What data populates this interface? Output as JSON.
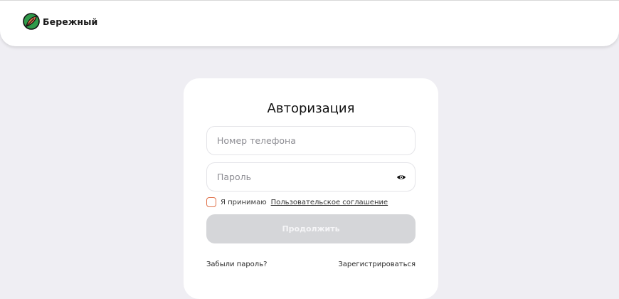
{
  "header": {
    "brand": "Бережный"
  },
  "auth": {
    "title": "Авторизация",
    "phone": {
      "placeholder": "Номер телефона",
      "value": ""
    },
    "password": {
      "placeholder": "Пароль",
      "value": ""
    },
    "agreement": {
      "prefix": "Я принимаю",
      "link": "Пользовательское соглашение",
      "checked": false
    },
    "submit_label": "Продолжить",
    "forgot_label": "Забыли пароль?",
    "register_label": "Зарегистрироваться"
  },
  "colors": {
    "page_bg": "#efeef3",
    "brand_green": "#2f9a4a",
    "brand_orange": "#e0714a",
    "button_disabled": "#d5d6d9"
  },
  "icons": {
    "logo": "leaf-logo-icon",
    "password_toggle": "eye-icon"
  }
}
